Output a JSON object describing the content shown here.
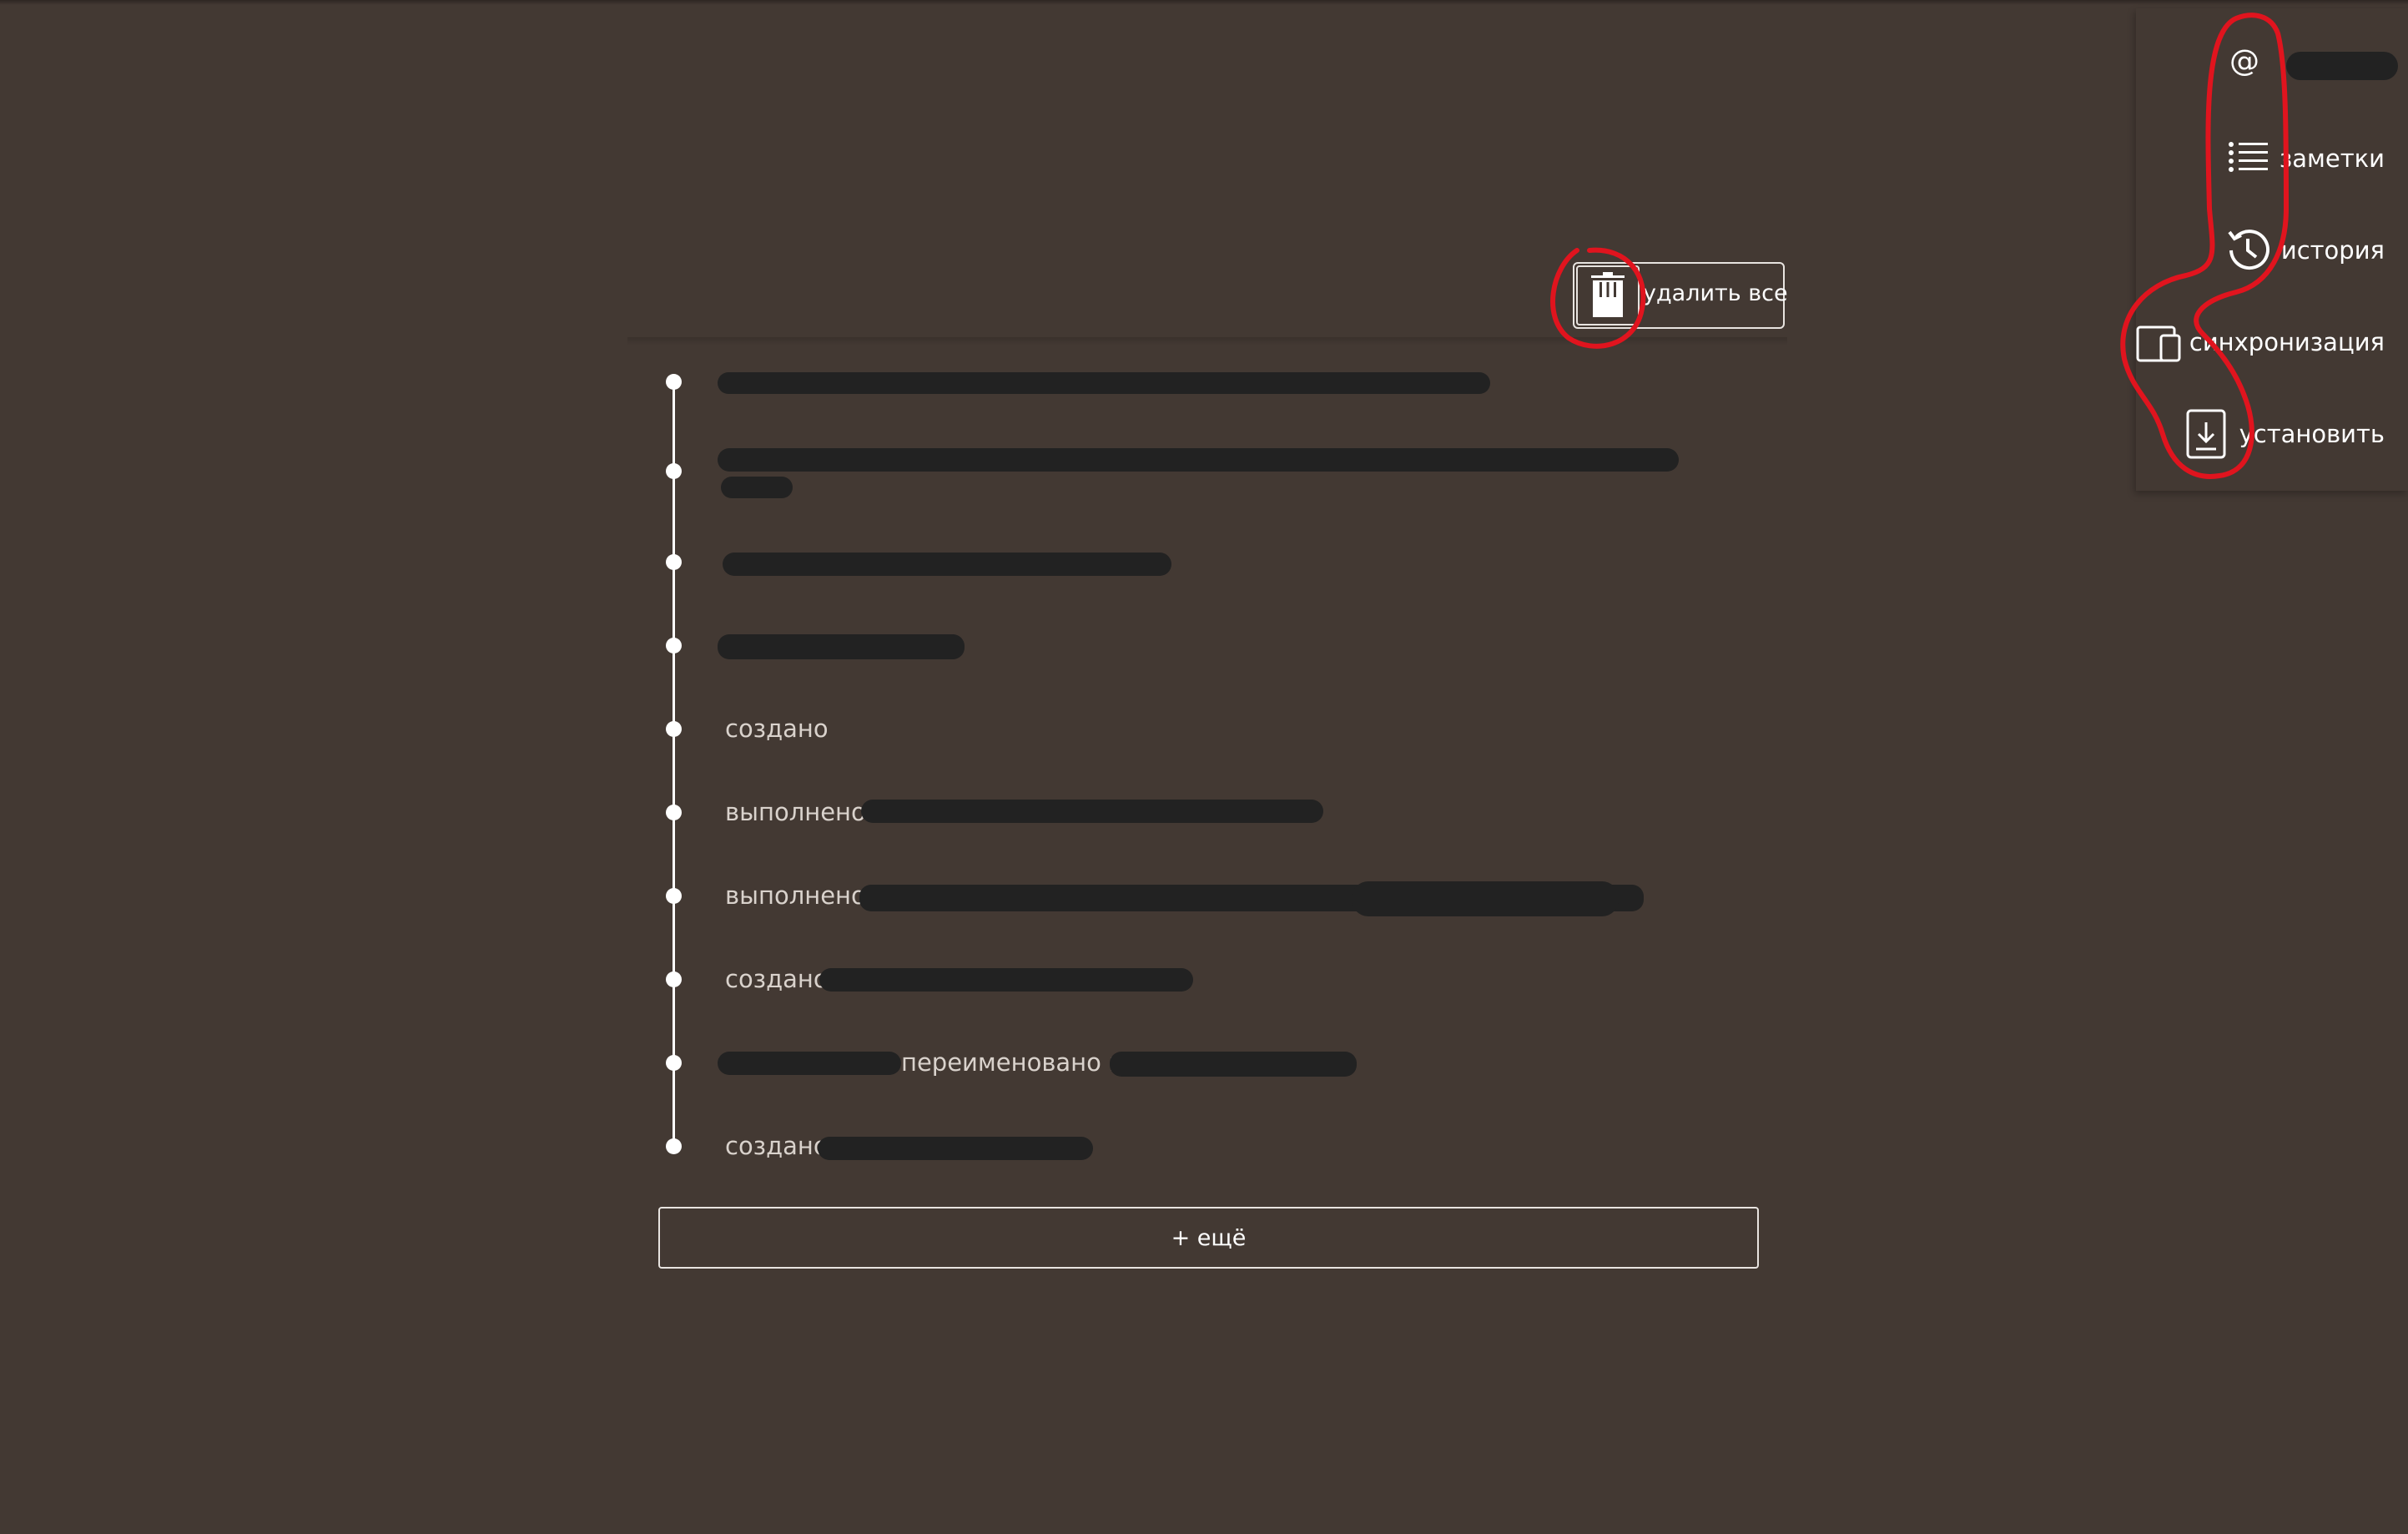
{
  "menu": {
    "items": [
      {
        "id": "account",
        "label": "",
        "icon": "at-sign-icon"
      },
      {
        "id": "notes",
        "label": "заметки",
        "icon": "list-icon"
      },
      {
        "id": "history",
        "label": "история",
        "icon": "history-icon"
      },
      {
        "id": "sync",
        "label": "синхронизация",
        "icon": "devices-icon"
      },
      {
        "id": "install",
        "label": "установить",
        "icon": "download-icon"
      }
    ]
  },
  "toolbar": {
    "delete_all_label": "удалить все",
    "delete_icon": "trash-icon"
  },
  "timeline": {
    "items": [
      {
        "text": ""
      },
      {
        "text": ""
      },
      {
        "text": ""
      },
      {
        "text": ""
      },
      {
        "text": "создано"
      },
      {
        "text": "выполнено"
      },
      {
        "text": "выполнено"
      },
      {
        "text": "создано"
      },
      {
        "text": "переименовано в"
      },
      {
        "text": "создано"
      }
    ]
  },
  "more_button_label": "+ ещё",
  "colors": {
    "background": "#433933",
    "redaction": "#222222",
    "annotation": "#e0141e",
    "text": "#d9d2cc"
  }
}
